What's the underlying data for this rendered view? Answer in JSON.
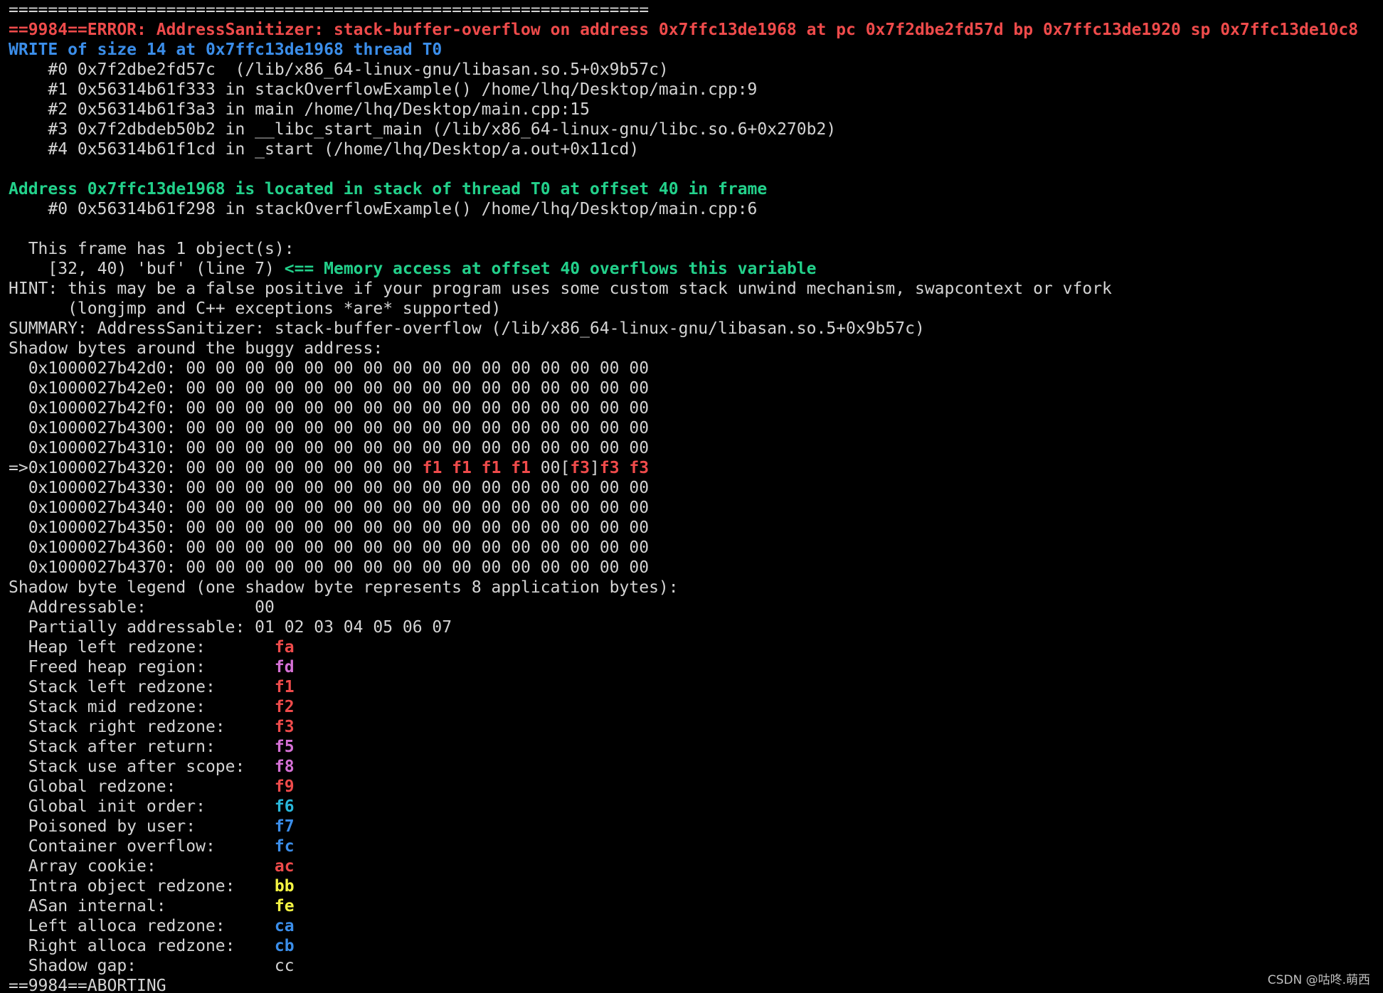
{
  "colors": {
    "background": "#000000",
    "default": "#d4d4d4",
    "red": "#ef4b4b",
    "blue": "#3b8eea",
    "green": "#23d18b",
    "magenta": "#d670d6",
    "cyan": "#29b8db",
    "yellow": "#f5f543"
  },
  "lines": [
    {
      "segments": [
        {
          "text": "=================================================================",
          "color": "default"
        }
      ]
    },
    {
      "segments": [
        {
          "text": "==9984==ERROR: AddressSanitizer: stack-buffer-overflow on address 0x7ffc13de1968 at pc 0x7f2dbe2fd57d bp 0x7ffc13de1920 sp 0x7ffc13de10c8",
          "color": "red"
        }
      ]
    },
    {
      "segments": [
        {
          "text": "WRITE of size 14 at 0x7ffc13de1968 thread T0",
          "color": "blue"
        }
      ]
    },
    {
      "segments": [
        {
          "text": "    #0 0x7f2dbe2fd57c  (/lib/x86_64-linux-gnu/libasan.so.5+0x9b57c)",
          "color": "default"
        }
      ]
    },
    {
      "segments": [
        {
          "text": "    #1 0x56314b61f333 in stackOverflowExample() /home/lhq/Desktop/main.cpp:9",
          "color": "default"
        }
      ]
    },
    {
      "segments": [
        {
          "text": "    #2 0x56314b61f3a3 in main /home/lhq/Desktop/main.cpp:15",
          "color": "default"
        }
      ]
    },
    {
      "segments": [
        {
          "text": "    #3 0x7f2dbdeb50b2 in __libc_start_main (/lib/x86_64-linux-gnu/libc.so.6+0x270b2)",
          "color": "default"
        }
      ]
    },
    {
      "segments": [
        {
          "text": "    #4 0x56314b61f1cd in _start (/home/lhq/Desktop/a.out+0x11cd)",
          "color": "default"
        }
      ]
    },
    {
      "segments": [
        {
          "text": "",
          "color": "default"
        }
      ]
    },
    {
      "segments": [
        {
          "text": "Address 0x7ffc13de1968 is located in stack of thread T0 at offset 40 in frame",
          "color": "green"
        }
      ]
    },
    {
      "segments": [
        {
          "text": "    #0 0x56314b61f298 in stackOverflowExample() /home/lhq/Desktop/main.cpp:6",
          "color": "default"
        }
      ]
    },
    {
      "segments": [
        {
          "text": "",
          "color": "default"
        }
      ]
    },
    {
      "segments": [
        {
          "text": "  This frame has 1 object(s):",
          "color": "default"
        }
      ]
    },
    {
      "segments": [
        {
          "text": "    [32, 40) 'buf' (line 7) ",
          "color": "default"
        },
        {
          "text": "<== Memory access at offset 40 overflows this variable",
          "color": "green"
        }
      ]
    },
    {
      "segments": [
        {
          "text": "HINT: this may be a false positive if your program uses some custom stack unwind mechanism, swapcontext or vfork",
          "color": "default"
        }
      ]
    },
    {
      "segments": [
        {
          "text": "      (longjmp and C++ exceptions *are* supported)",
          "color": "default"
        }
      ]
    },
    {
      "segments": [
        {
          "text": "SUMMARY: AddressSanitizer: stack-buffer-overflow (/lib/x86_64-linux-gnu/libasan.so.5+0x9b57c)",
          "color": "default"
        }
      ]
    },
    {
      "segments": [
        {
          "text": "Shadow bytes around the buggy address:",
          "color": "default"
        }
      ]
    },
    {
      "segments": [
        {
          "text": "  0x1000027b42d0: 00 00 00 00 00 00 00 00 00 00 00 00 00 00 00 00",
          "color": "default"
        }
      ]
    },
    {
      "segments": [
        {
          "text": "  0x1000027b42e0: 00 00 00 00 00 00 00 00 00 00 00 00 00 00 00 00",
          "color": "default"
        }
      ]
    },
    {
      "segments": [
        {
          "text": "  0x1000027b42f0: 00 00 00 00 00 00 00 00 00 00 00 00 00 00 00 00",
          "color": "default"
        }
      ]
    },
    {
      "segments": [
        {
          "text": "  0x1000027b4300: 00 00 00 00 00 00 00 00 00 00 00 00 00 00 00 00",
          "color": "default"
        }
      ]
    },
    {
      "segments": [
        {
          "text": "  0x1000027b4310: 00 00 00 00 00 00 00 00 00 00 00 00 00 00 00 00",
          "color": "default"
        }
      ]
    },
    {
      "segments": [
        {
          "text": "=>0x1000027b4320: 00 00 00 00 00 00 00 00 ",
          "color": "default"
        },
        {
          "text": "f1 f1 f1 f1",
          "color": "red"
        },
        {
          "text": " 00[",
          "color": "default"
        },
        {
          "text": "f3",
          "color": "red"
        },
        {
          "text": "]",
          "color": "default"
        },
        {
          "text": "f3 f3",
          "color": "red"
        }
      ]
    },
    {
      "segments": [
        {
          "text": "  0x1000027b4330: 00 00 00 00 00 00 00 00 00 00 00 00 00 00 00 00",
          "color": "default"
        }
      ]
    },
    {
      "segments": [
        {
          "text": "  0x1000027b4340: 00 00 00 00 00 00 00 00 00 00 00 00 00 00 00 00",
          "color": "default"
        }
      ]
    },
    {
      "segments": [
        {
          "text": "  0x1000027b4350: 00 00 00 00 00 00 00 00 00 00 00 00 00 00 00 00",
          "color": "default"
        }
      ]
    },
    {
      "segments": [
        {
          "text": "  0x1000027b4360: 00 00 00 00 00 00 00 00 00 00 00 00 00 00 00 00",
          "color": "default"
        }
      ]
    },
    {
      "segments": [
        {
          "text": "  0x1000027b4370: 00 00 00 00 00 00 00 00 00 00 00 00 00 00 00 00",
          "color": "default"
        }
      ]
    },
    {
      "segments": [
        {
          "text": "Shadow byte legend (one shadow byte represents 8 application bytes):",
          "color": "default"
        }
      ]
    },
    {
      "segments": [
        {
          "text": "  Addressable:           00",
          "color": "default"
        }
      ]
    },
    {
      "segments": [
        {
          "text": "  Partially addressable: 01 02 03 04 05 06 07",
          "color": "default"
        }
      ]
    },
    {
      "segments": [
        {
          "text": "  Heap left redzone:       ",
          "color": "default"
        },
        {
          "text": "fa",
          "color": "red"
        }
      ]
    },
    {
      "segments": [
        {
          "text": "  Freed heap region:       ",
          "color": "default"
        },
        {
          "text": "fd",
          "color": "magenta"
        }
      ]
    },
    {
      "segments": [
        {
          "text": "  Stack left redzone:      ",
          "color": "default"
        },
        {
          "text": "f1",
          "color": "red"
        }
      ]
    },
    {
      "segments": [
        {
          "text": "  Stack mid redzone:       ",
          "color": "default"
        },
        {
          "text": "f2",
          "color": "red"
        }
      ]
    },
    {
      "segments": [
        {
          "text": "  Stack right redzone:     ",
          "color": "default"
        },
        {
          "text": "f3",
          "color": "red"
        }
      ]
    },
    {
      "segments": [
        {
          "text": "  Stack after return:      ",
          "color": "default"
        },
        {
          "text": "f5",
          "color": "magenta"
        }
      ]
    },
    {
      "segments": [
        {
          "text": "  Stack use after scope:   ",
          "color": "default"
        },
        {
          "text": "f8",
          "color": "magenta"
        }
      ]
    },
    {
      "segments": [
        {
          "text": "  Global redzone:          ",
          "color": "default"
        },
        {
          "text": "f9",
          "color": "red"
        }
      ]
    },
    {
      "segments": [
        {
          "text": "  Global init order:       ",
          "color": "default"
        },
        {
          "text": "f6",
          "color": "cyan"
        }
      ]
    },
    {
      "segments": [
        {
          "text": "  Poisoned by user:        ",
          "color": "default"
        },
        {
          "text": "f7",
          "color": "blue"
        }
      ]
    },
    {
      "segments": [
        {
          "text": "  Container overflow:      ",
          "color": "default"
        },
        {
          "text": "fc",
          "color": "blue"
        }
      ]
    },
    {
      "segments": [
        {
          "text": "  Array cookie:            ",
          "color": "default"
        },
        {
          "text": "ac",
          "color": "red"
        }
      ]
    },
    {
      "segments": [
        {
          "text": "  Intra object redzone:    ",
          "color": "default"
        },
        {
          "text": "bb",
          "color": "yellow"
        }
      ]
    },
    {
      "segments": [
        {
          "text": "  ASan internal:           ",
          "color": "default"
        },
        {
          "text": "fe",
          "color": "yellow"
        }
      ]
    },
    {
      "segments": [
        {
          "text": "  Left alloca redzone:     ",
          "color": "default"
        },
        {
          "text": "ca",
          "color": "blue"
        }
      ]
    },
    {
      "segments": [
        {
          "text": "  Right alloca redzone:    ",
          "color": "default"
        },
        {
          "text": "cb",
          "color": "blue"
        }
      ]
    },
    {
      "segments": [
        {
          "text": "  Shadow gap:              cc",
          "color": "default"
        }
      ]
    },
    {
      "segments": [
        {
          "text": "==9984==ABORTING",
          "color": "default"
        }
      ]
    }
  ],
  "watermark": "CSDN @咕咚.萌西"
}
